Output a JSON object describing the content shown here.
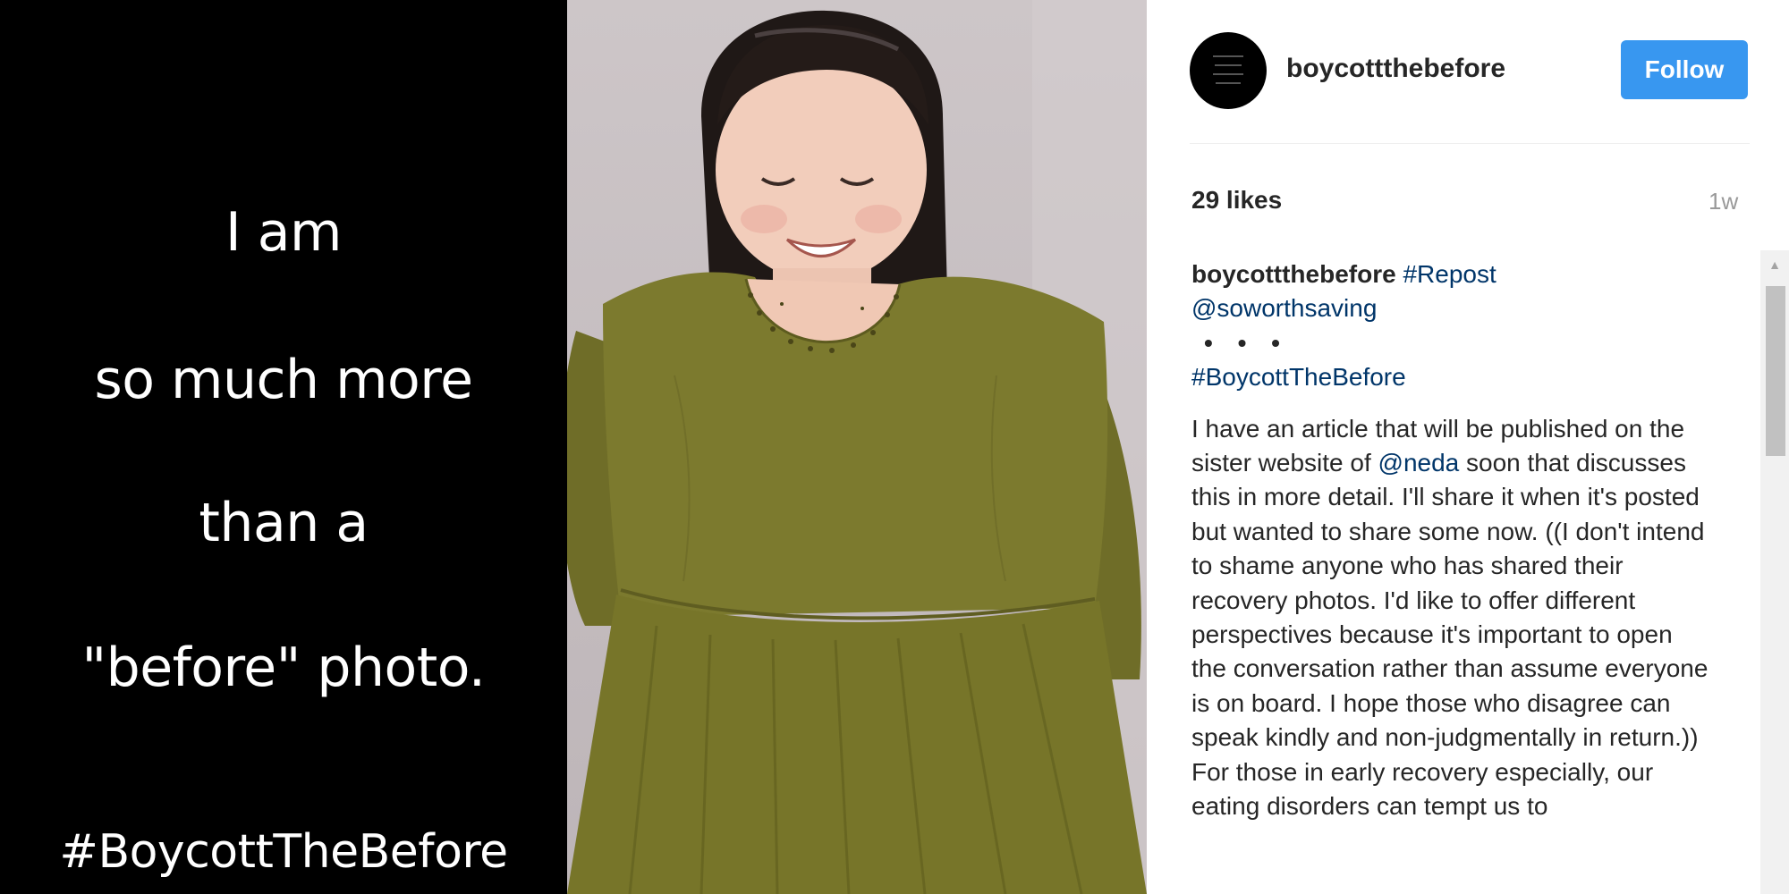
{
  "quote": {
    "line1": "I am",
    "line2": "so much more",
    "line3": "than a",
    "line4": "\"before\" photo.",
    "hashtag": "#BoycottTheBefore"
  },
  "post": {
    "username": "boycottthebefore",
    "follow_label": "Follow",
    "likes": "29 likes",
    "timestamp": "1w",
    "caption": {
      "author": "boycottthebefore",
      "repost_tag": "#Repost",
      "mention": "@soworthsaving",
      "dots": "• • •",
      "hashtag": "#BoycottTheBefore",
      "body_before_mention": "I have an article that will be published on the sister website of",
      "body_mention": "@neda",
      "body_after_mention": "soon that discusses this in more detail. I'll share it when it's posted but wanted to share some now. ((I don't intend to shame anyone who has shared their recovery photos. I'd like to offer different perspectives because it's important to open the conversation rather than assume everyone is on board. I hope those who disagree can speak kindly and non-judgmentally in return.)) For those in early recovery especially, our eating disorders can tempt us to"
    }
  },
  "colors": {
    "follow_button": "#3897f0",
    "link": "#003569",
    "dress": "#7c7a2e"
  },
  "icons": {
    "scroll_up": "triangle-up-icon"
  }
}
